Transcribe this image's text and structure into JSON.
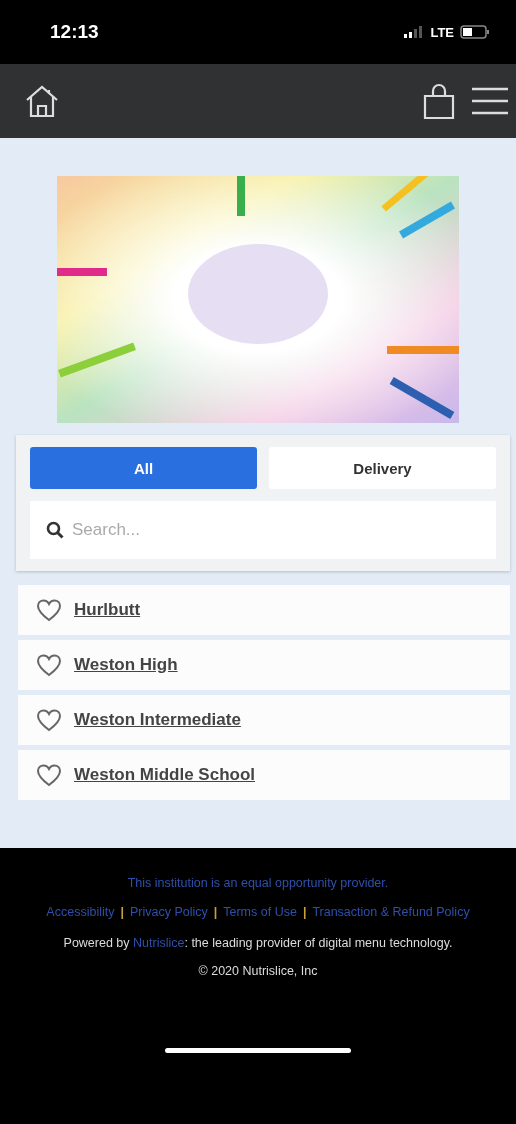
{
  "status_bar": {
    "time": "12:13",
    "network": "LTE"
  },
  "filter": {
    "tabs": [
      {
        "label": "All",
        "selected": true
      },
      {
        "label": "Delivery",
        "selected": false
      }
    ],
    "search": {
      "placeholder": "Search..."
    }
  },
  "schools": [
    {
      "name": "Hurlbutt",
      "favorite": false
    },
    {
      "name": "Weston High",
      "favorite": false
    },
    {
      "name": "Weston Intermediate",
      "favorite": false
    },
    {
      "name": "Weston Middle School",
      "favorite": false
    }
  ],
  "footer": {
    "notice": "This institution is an equal opportunity provider.",
    "links": [
      {
        "label": "Accessibility"
      },
      {
        "label": "Privacy Policy"
      },
      {
        "label": "Terms of Use"
      },
      {
        "label": "Transaction & Refund Policy"
      }
    ],
    "separators": [
      "|",
      "|",
      "|"
    ],
    "powered_by": {
      "prefix": "Powered by ",
      "link": "Nutrislice",
      "suffix": ": the leading provider of digital menu technology."
    },
    "copyright": "© 2020 Nutrislice, Inc"
  }
}
